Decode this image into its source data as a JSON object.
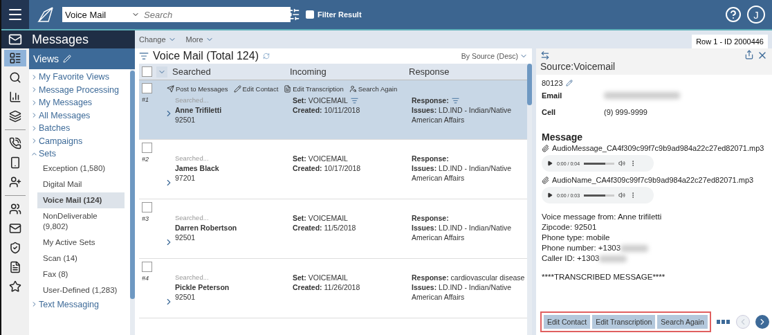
{
  "top_bar": {
    "view_select": "Voice Mail",
    "search": {
      "placeholder": "Search"
    },
    "filter_result": {
      "label": "Filter Result",
      "checked": false
    },
    "user_initial": "J"
  },
  "module": {
    "title": "Messages"
  },
  "rail": [
    {
      "kind": "views",
      "selected": true
    },
    {
      "kind": "search",
      "selected": false
    },
    {
      "kind": "chart",
      "selected": false
    },
    {
      "kind": "layers",
      "selected": false
    },
    {
      "kind": "divider"
    },
    {
      "kind": "phone",
      "selected": false
    },
    {
      "kind": "mobile",
      "selected": false
    },
    {
      "kind": "add-user",
      "selected": false
    },
    {
      "kind": "divider"
    },
    {
      "kind": "users",
      "selected": false
    },
    {
      "kind": "mail",
      "selected": false
    },
    {
      "kind": "badge",
      "selected": false
    },
    {
      "kind": "document",
      "selected": false
    },
    {
      "kind": "star",
      "selected": false
    }
  ],
  "views": {
    "title": "Views"
  },
  "nav": [
    {
      "label": "My Favorite Views",
      "expanded": false
    },
    {
      "label": "Message Processing",
      "expanded": false
    },
    {
      "label": "My Messages",
      "expanded": false
    },
    {
      "label": "All Messages",
      "expanded": false
    },
    {
      "label": "Batches",
      "expanded": false
    },
    {
      "label": "Campaigns",
      "expanded": false
    },
    {
      "label": "Sets",
      "expanded": true,
      "children": [
        {
          "label": "Exception (1,580)",
          "selected": false
        },
        {
          "label": "Digital Mail",
          "selected": false
        },
        {
          "label": "Voice Mail (124)",
          "selected": true
        },
        {
          "label": "NonDeliverable (9,802)",
          "selected": false
        },
        {
          "label": "My Active Sets",
          "selected": false
        },
        {
          "label": "Scan (14)",
          "selected": false
        },
        {
          "label": "Fax (8)",
          "selected": false
        },
        {
          "label": "User-Defined (1,283)",
          "selected": false
        }
      ]
    },
    {
      "label": "Text Messaging",
      "expanded": false
    }
  ],
  "toolbar": [
    {
      "label": "Change"
    },
    {
      "label": "More"
    }
  ],
  "row_badge": "Row 1 - ID 2000446",
  "list": {
    "title": "Voice Mail (Total 124)",
    "sort": "By Source (Desc)",
    "columns": [
      "Searched",
      "Incoming",
      "Response"
    ],
    "select_all": {
      "checked": false
    },
    "actions": [
      {
        "kind": "post",
        "label": "Post to Messages"
      },
      {
        "kind": "edit",
        "label": "Edit Contact"
      },
      {
        "kind": "doc",
        "label": "Edit Transcription"
      },
      {
        "kind": "search",
        "label": "Search Again"
      }
    ],
    "rows": [
      {
        "number": "#1",
        "selected": true,
        "checked": false,
        "searched": "Searched...",
        "name": "Anne Trifiletti",
        "zip": "92501",
        "set": "**Set:**  VOICEMAIL",
        "set_filter": true,
        "created": "**Created:** 10/11/2018",
        "response": "**Response:**",
        "response_filter": true,
        "issues": "**Issues:** LD.IND - Indian/Native American Affairs"
      },
      {
        "number": "#2",
        "selected": false,
        "checked": false,
        "searched": "Searched...",
        "name": "James Black",
        "zip": "97201",
        "set": "**Set:**  VOICEMAIL",
        "set_filter": false,
        "created": "**Created:** 10/17/2018",
        "response": "**Response:**",
        "response_filter": false,
        "issues": "**Issues:** LD.IND - Indian/Native American Affairs"
      },
      {
        "number": "#3",
        "selected": false,
        "checked": false,
        "searched": "Searched...",
        "name": "Darren Robertson",
        "zip": "92501",
        "set": "**Set:**  VOICEMAIL",
        "set_filter": false,
        "created": "**Created:** 11/5/2018",
        "response": "**Response:**",
        "response_filter": false,
        "issues": "**Issues:** LD.IND - Indian/Native American Affairs"
      },
      {
        "number": "#4",
        "selected": false,
        "checked": false,
        "searched": "Searched...",
        "name": "Pickle Peterson",
        "zip": "92501",
        "set": "**Set:**  VOICEMAIL",
        "set_filter": false,
        "created": "**Created:** 11/26/2018",
        "response": "**Response:**  cardiovascular disease",
        "response_filter": false,
        "issues": "**Issues:** LD.IND - Indian/Native American Affairs"
      }
    ]
  },
  "detail": {
    "title": "Source:Voicemail",
    "id": "80123",
    "fields": [
      {
        "label": "Email",
        "kind": "blurred"
      },
      {
        "label": "Cell",
        "kind": "text",
        "value": "(9) 999-9999"
      }
    ],
    "message_heading": "Message",
    "attachments": [
      {
        "name": "AudioMessage_CA4f309c99f7c9b9ad984a22c27ed82071.mp3",
        "time": "0:00 / 0:04",
        "level": 0.7
      },
      {
        "name": "AudioName_CA4f309c99f7c9b9ad984a22c27ed82071.mp3",
        "time": "0:00 / 0:03",
        "level": 0.7
      }
    ],
    "transcript": [
      {
        "text": "Voice message from: Anne trifiletti",
        "redacted": false
      },
      {
        "text": "Zipcode: 92501",
        "redacted": false
      },
      {
        "text": "Phone type: mobile",
        "redacted": false
      },
      {
        "text": "Phone number: +1303",
        "redacted": true
      },
      {
        "text": "Caller ID: +1303",
        "redacted": true
      }
    ],
    "transcribed": "****TRANSCRIBED MESSAGE****",
    "buttons": [
      "Edit Contact",
      "Edit Transcription",
      "Search Again"
    ],
    "pager": [
      {
        "kind": "prev",
        "disabled": true
      },
      {
        "kind": "next",
        "disabled": false
      }
    ]
  }
}
